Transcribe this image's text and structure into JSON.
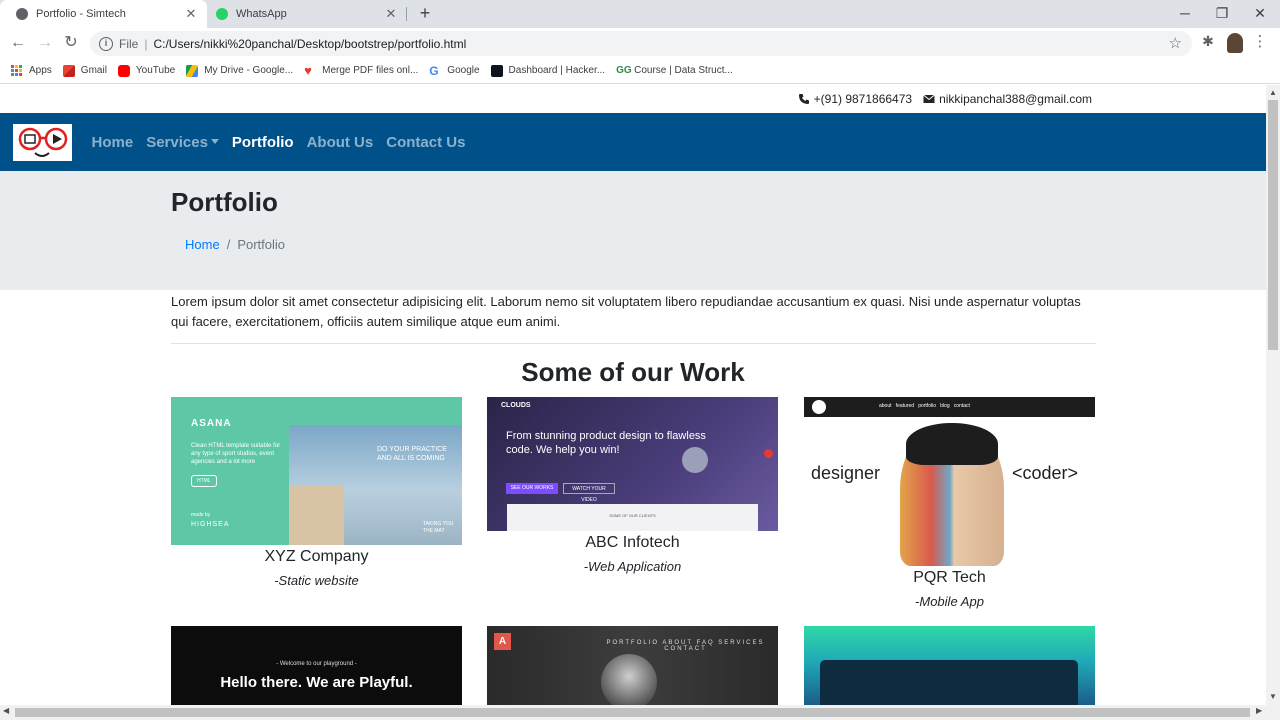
{
  "browser": {
    "tabs": [
      {
        "title": "Portfolio - Simtech",
        "active": true,
        "icon": "globe-icon"
      },
      {
        "title": "WhatsApp",
        "active": false,
        "icon": "whatsapp-icon"
      }
    ],
    "url_scheme": "File",
    "url": "C:/Users/nikki%20panchal/Desktop/bootstrep/portfolio.html",
    "bookmarks": [
      {
        "label": "Apps",
        "icon": "apps-grid-icon"
      },
      {
        "label": "Gmail",
        "icon": "gmail-icon"
      },
      {
        "label": "YouTube",
        "icon": "youtube-icon"
      },
      {
        "label": "My Drive - Google...",
        "icon": "google-drive-icon"
      },
      {
        "label": "Merge PDF files onl...",
        "icon": "heart-icon"
      },
      {
        "label": "Google",
        "icon": "google-icon"
      },
      {
        "label": "Dashboard | Hacker...",
        "icon": "hackerrank-icon"
      },
      {
        "label": "Course | Data Struct...",
        "icon": "geeksforgeeks-icon"
      }
    ]
  },
  "contact": {
    "phone": "+(91) 9871866473",
    "email": "nikkipanchal388@gmail.com"
  },
  "nav": {
    "home": "Home",
    "services": "Services",
    "portfolio": "Portfolio",
    "about": "About Us",
    "contact": "Contact Us",
    "bg_color": "#00518a"
  },
  "header": {
    "title": "Portfolio",
    "breadcrumb_home": "Home",
    "breadcrumb_current": "Portfolio"
  },
  "intro": "Lorem ipsum dolor sit amet consectetur adipisicing elit. Laborum nemo sit voluptatem libero repudiandae accusantium ex quasi. Nisi unde aspernatur voluptas qui facere, exercitationem, officiis autem similique atque eum animi.",
  "works": {
    "title": "Some of our Work",
    "items": [
      {
        "name": "XYZ Company",
        "type": "-Static website",
        "thumb_text": {
          "brand": "ASANA",
          "tagline": "Clean HTML template suitable for any type of sport studios, event agencies and a lot more",
          "button": "HTML",
          "footer": "made by",
          "footer_brand": "HIGHSEA",
          "panel_text": "DO YOUR PRACTICE AND ALL IS COMING",
          "corner_text": "TAKING YOU THE MAT"
        }
      },
      {
        "name": "ABC Infotech",
        "type": "-Web Application",
        "thumb_text": {
          "brand": "CLOUDS",
          "headline": "From stunning product design to flawless code. We help you win!",
          "button1": "SEE OUR WORKS",
          "button2": "WATCH YOUR VIDEO",
          "footer": "SOME OF OUR CLIENTS"
        }
      },
      {
        "name": "PQR Tech",
        "type": "-Mobile App",
        "thumb_text": {
          "left_word": "designer",
          "right_word": "<coder>",
          "menu": "about   featured   portfolio   blog   contact"
        }
      }
    ],
    "row2": [
      {
        "welcome": "- Welcome to our playground -",
        "hello": "Hello there. We are Playful."
      },
      {
        "logo": "A",
        "menu": "PORTFOLIO  ABOUT  FAQ  SERVICES  CONTACT"
      },
      {}
    ]
  }
}
